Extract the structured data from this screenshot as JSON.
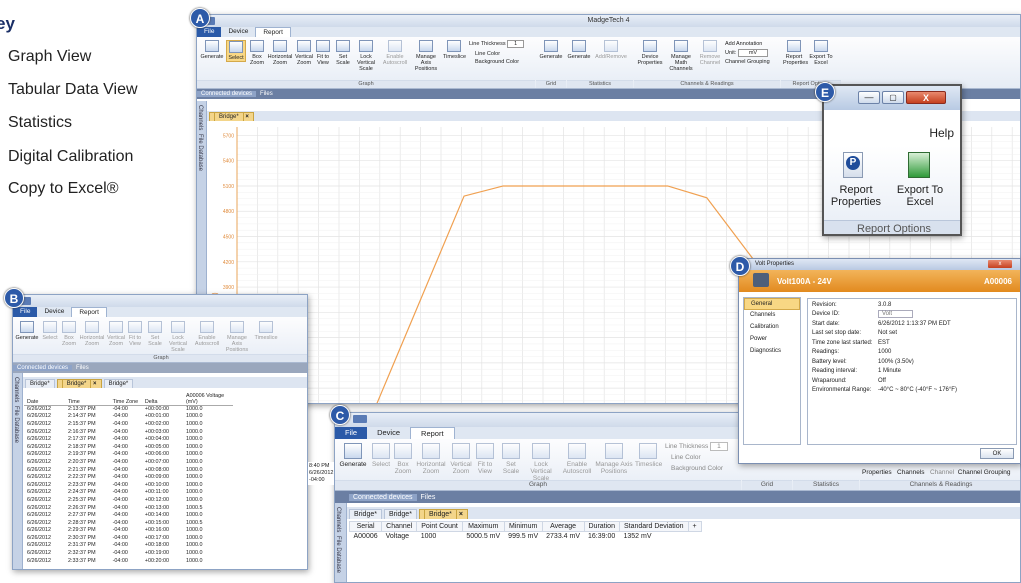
{
  "legend": {
    "title": "ey",
    "items": [
      "Graph View",
      "Tabular Data View",
      "Statistics",
      "Digital Calibration",
      "Copy to Excel®"
    ]
  },
  "badges": {
    "a": "A",
    "b": "B",
    "c": "C",
    "d": "D",
    "e": "E"
  },
  "app_title": "MadgeTech 4",
  "tabs": {
    "file": "File",
    "device": "Device",
    "report": "Report"
  },
  "ribbon": {
    "generate": "Generate",
    "select": "Select",
    "box_zoom": "Box Zoom",
    "horizontal_zoom": "Horizontal Zoom",
    "vertical_zoom": "Vertical Zoom",
    "fit_to_view": "Fit to View",
    "set_scale": "Set Scale",
    "lock_vertical_scale": "Lock Vertical Scale",
    "enable_autoscroll": "Enable Autoscroll",
    "manage_axis_positions": "Manage Axis Positions",
    "timeslice": "Timeslice",
    "line_thickness": "Line Thickness",
    "line_thickness_value": "1",
    "line_color": "Line Color",
    "background_color": "Background Color",
    "grid_generate": "Generate",
    "stats_generate": "Generate",
    "add_remove": "Add/Remove",
    "device_properties": "Device Properties",
    "manage_math_channels": "Manage Math Channels",
    "remove_channel": "Remove Channel",
    "add_annotation": "Add Annotation",
    "unit": "Unit:",
    "unit_value": "mV",
    "channel_grouping": "Channel Grouping",
    "report_properties": "Report Properties",
    "export_to_excel": "Export To Excel",
    "groups": {
      "graph": "Graph",
      "grid": "Grid",
      "statistics": "Statistics",
      "channels_readings": "Channels & Readings",
      "report_options": "Report Options"
    }
  },
  "side": {
    "channels": "Channels",
    "file_database": "File Database"
  },
  "subtabs": {
    "connected": "Connected devices",
    "files": "Files"
  },
  "doc_tab": "Bridge*",
  "doc_tab_close": "×",
  "graph": {
    "ylabel": "Millivolts (mV)",
    "yticks": [
      "5700",
      "5400",
      "5100",
      "4800",
      "4500",
      "4200",
      "3900",
      "3600",
      "3300",
      "3000",
      "2700"
    ],
    "ymin": 2500,
    "ymax": 5800,
    "line_color": "#f0a050",
    "points": [
      [
        0,
        1220
      ],
      [
        0.12,
        1220
      ],
      [
        0.29,
        4980
      ],
      [
        0.34,
        5100
      ],
      [
        0.55,
        5100
      ],
      [
        0.6,
        4960
      ],
      [
        0.8,
        2500
      ],
      [
        0.86,
        2440
      ],
      [
        1,
        2440
      ]
    ]
  },
  "excel_zoom": {
    "help": "Help",
    "report_properties": "Report Properties",
    "export_to_excel": "Export To Excel",
    "group": "Report Options"
  },
  "props": {
    "title": "Volt Properties",
    "device": "Volt100A - 24V",
    "serial": "A00006",
    "nav": [
      "General",
      "Channels",
      "Calibration",
      "Power",
      "Diagnostics"
    ],
    "rows": [
      {
        "k": "Revision:",
        "v": "3.0.8"
      },
      {
        "k": "Device ID:",
        "v": "Volt"
      },
      {
        "k": "Start date:",
        "v": "6/26/2012 1:13:37 PM EDT"
      },
      {
        "k": "Last set stop date:",
        "v": "Not set"
      },
      {
        "k": "Time zone last started:",
        "v": "EST"
      },
      {
        "k": "Readings:",
        "v": "1000"
      },
      {
        "k": "Battery level:",
        "v": "100%   (3.50v)"
      },
      {
        "k": "Reading interval:",
        "v": "1 Minute"
      },
      {
        "k": "Wraparound:",
        "v": "Off"
      },
      {
        "k": "Environmental Range:",
        "v": "-40°C ~ 80°C (-40°F ~ 176°F)"
      }
    ],
    "ok": "OK",
    "close": "x"
  },
  "table_b": {
    "headers": [
      "Date",
      "Time",
      "Time Zone",
      "Delta",
      "A00006 Voltage (mV)"
    ],
    "rows": [
      [
        "6/26/2012",
        "2:13:37 PM",
        "-04:00",
        "+00:00:00",
        "1000.0"
      ],
      [
        "6/26/2012",
        "2:14:37 PM",
        "-04:00",
        "+00:01:00",
        "1000.0"
      ],
      [
        "6/26/2012",
        "2:15:37 PM",
        "-04:00",
        "+00:02:00",
        "1000.0"
      ],
      [
        "6/26/2012",
        "2:16:37 PM",
        "-04:00",
        "+00:03:00",
        "1000.0"
      ],
      [
        "6/26/2012",
        "2:17:37 PM",
        "-04:00",
        "+00:04:00",
        "1000.0"
      ],
      [
        "6/26/2012",
        "2:18:37 PM",
        "-04:00",
        "+00:05:00",
        "1000.0"
      ],
      [
        "6/26/2012",
        "2:19:37 PM",
        "-04:00",
        "+00:06:00",
        "1000.0"
      ],
      [
        "6/26/2012",
        "2:20:37 PM",
        "-04:00",
        "+00:07:00",
        "1000.0"
      ],
      [
        "6/26/2012",
        "2:21:37 PM",
        "-04:00",
        "+00:08:00",
        "1000.0"
      ],
      [
        "6/26/2012",
        "2:22:37 PM",
        "-04:00",
        "+00:09:00",
        "1000.0"
      ],
      [
        "6/26/2012",
        "2:23:37 PM",
        "-04:00",
        "+00:10:00",
        "1000.0"
      ],
      [
        "6/26/2012",
        "2:24:37 PM",
        "-04:00",
        "+00:11:00",
        "1000.0"
      ],
      [
        "6/26/2012",
        "2:25:37 PM",
        "-04:00",
        "+00:12:00",
        "1000.0"
      ],
      [
        "6/26/2012",
        "2:26:37 PM",
        "-04:00",
        "+00:13:00",
        "1000.5"
      ],
      [
        "6/26/2012",
        "2:27:37 PM",
        "-04:00",
        "+00:14:00",
        "1000.0"
      ],
      [
        "6/26/2012",
        "2:28:37 PM",
        "-04:00",
        "+00:15:00",
        "1000.5"
      ],
      [
        "6/26/2012",
        "2:29:37 PM",
        "-04:00",
        "+00:16:00",
        "1000.0"
      ],
      [
        "6/26/2012",
        "2:30:37 PM",
        "-04:00",
        "+00:17:00",
        "1000.0"
      ],
      [
        "6/26/2012",
        "2:31:37 PM",
        "-04:00",
        "+00:18:00",
        "1000.0"
      ],
      [
        "6/26/2012",
        "2:32:37 PM",
        "-04:00",
        "+00:19:00",
        "1000.0"
      ],
      [
        "6/26/2012",
        "2:33:37 PM",
        "-04:00",
        "+00:20:00",
        "1000.0"
      ]
    ],
    "behind": {
      "time": "8:40 PM",
      "date": "6/26/2012",
      "tz": "-04:00"
    }
  },
  "stats_c": {
    "headers": [
      "Serial",
      "Channel",
      "Point Count",
      "Maximum",
      "Minimum",
      "Average",
      "Duration",
      "Standard Deviation",
      "+"
    ],
    "row": [
      "A00006",
      "Voltage",
      "1000",
      "5000.5 mV",
      "999.5 mV",
      "2733.4 mV",
      "16:39:00",
      "1352 mV",
      ""
    ]
  },
  "c_right": {
    "properties": "Properties",
    "channels": "Channels",
    "channel": "Channel",
    "channel_grouping": "Channel Grouping"
  }
}
